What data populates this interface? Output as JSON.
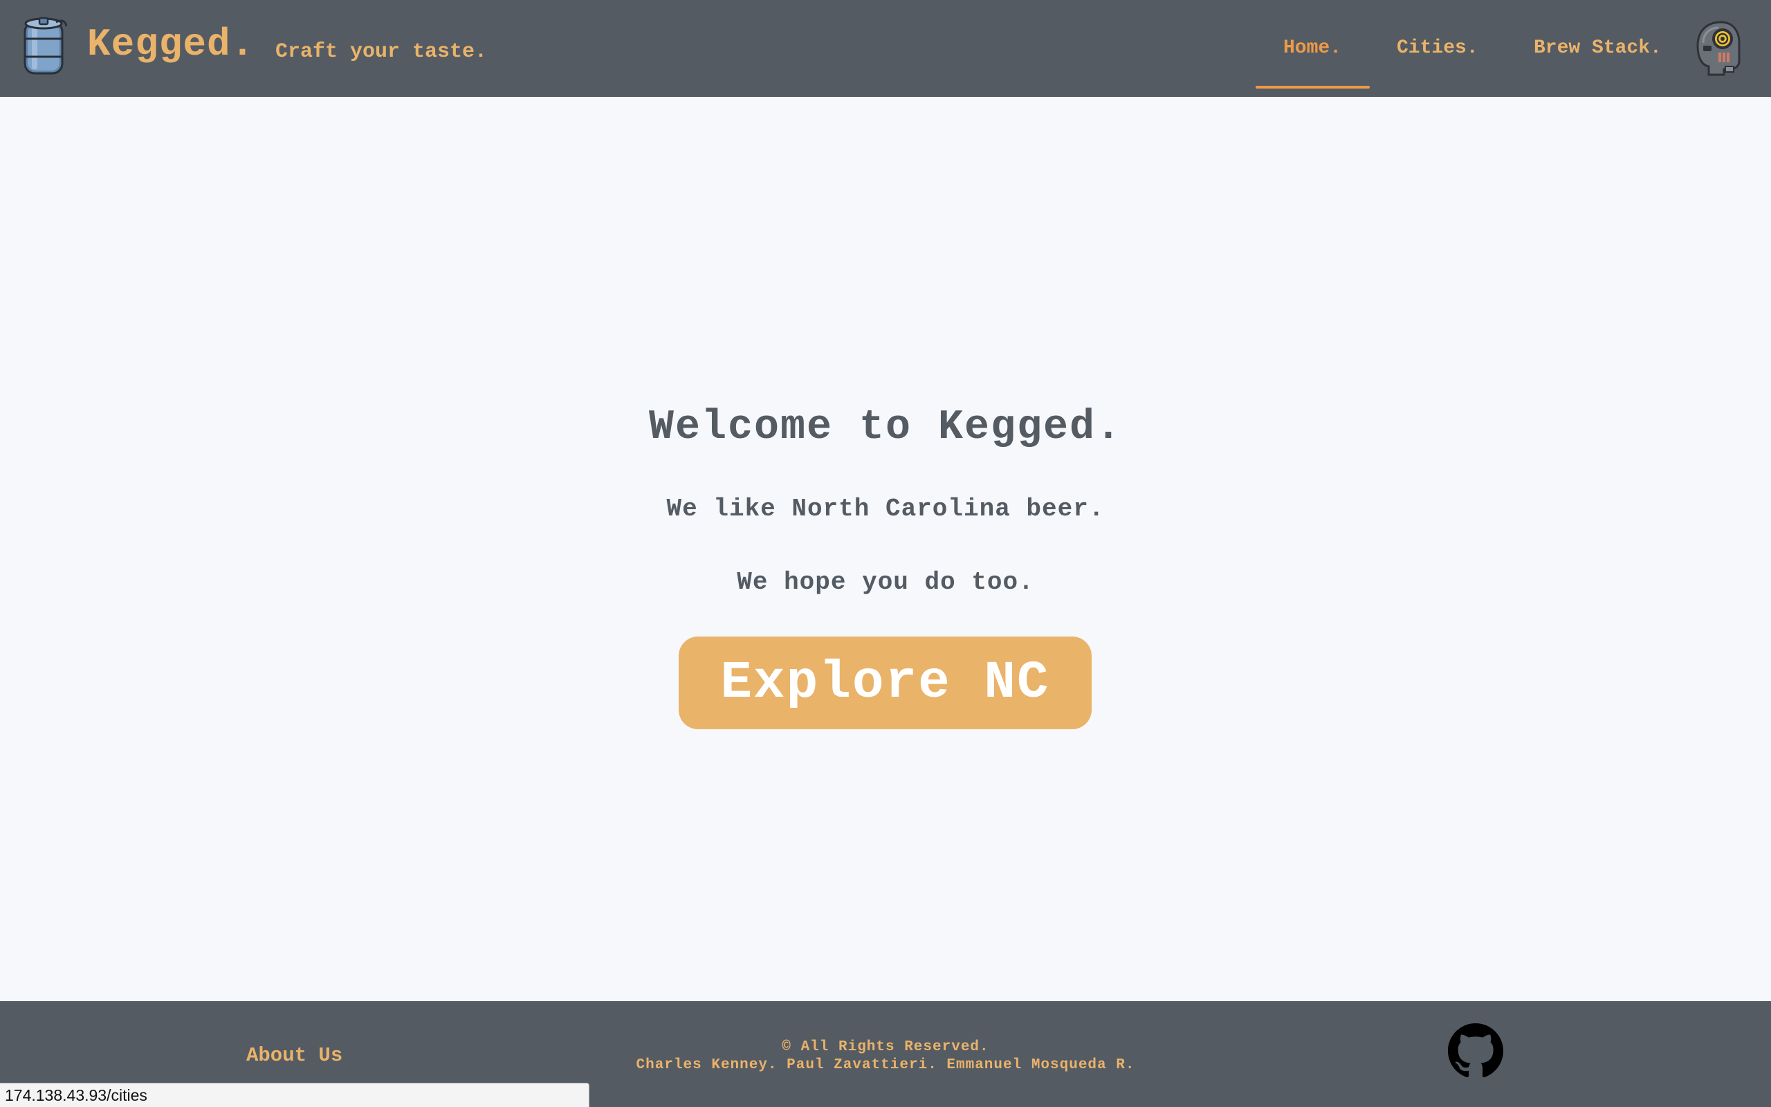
{
  "header": {
    "brand": "Kegged.",
    "tagline": "Craft your taste.",
    "nav": [
      {
        "label": "Home.",
        "active": true
      },
      {
        "label": "Cities.",
        "active": false
      },
      {
        "label": "Brew Stack.",
        "active": false
      }
    ]
  },
  "hero": {
    "title": "Welcome to Kegged.",
    "line1": "We like North Carolina beer.",
    "line2": "We hope you do too.",
    "cta": "Explore NC"
  },
  "footer": {
    "about": "About Us",
    "copyright": "© All Rights Reserved.",
    "authors": "Charles Kenney. Paul Zavattieri. Emmanuel Mosqueda R."
  },
  "status_bar": {
    "url": "174.138.43.93/cities"
  },
  "icons": {
    "logo": "keg-icon",
    "avatar": "robot-avatar-icon",
    "github": "github-icon"
  },
  "colors": {
    "header_bg": "#545b63",
    "accent": "#eab36a",
    "accent_active": "#ee9b46",
    "page_bg": "#f6f8fb",
    "text_dark": "#545b63"
  }
}
